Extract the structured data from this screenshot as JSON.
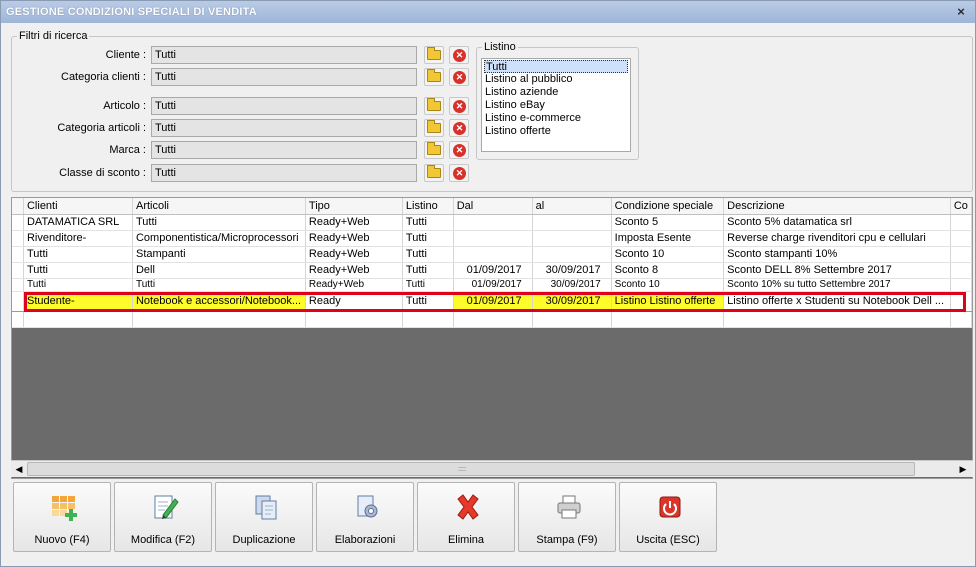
{
  "window": {
    "title": "GESTIONE CONDIZIONI SPECIALI DI VENDITA",
    "close_glyph": "×"
  },
  "filters": {
    "legend": "Filtri di ricerca",
    "rows": [
      {
        "label": "Cliente :",
        "value": "Tutti"
      },
      {
        "label": "Categoria clienti :",
        "value": "Tutti"
      },
      {
        "label": "Articolo :",
        "value": "Tutti"
      },
      {
        "label": "Categoria articoli :",
        "value": "Tutti"
      },
      {
        "label": "Marca :",
        "value": "Tutti"
      },
      {
        "label": "Classe di sconto :",
        "value": "Tutti"
      }
    ]
  },
  "listino": {
    "legend": "Listino",
    "options": [
      "Tutti",
      "Listino al pubblico",
      "Listino aziende",
      "Listino eBay",
      "Listino e-commerce",
      "Listino offerte"
    ],
    "selected": "Tutti"
  },
  "table": {
    "columns": [
      "Clienti",
      "Articoli",
      "Tipo",
      "Listino",
      "Dal",
      "al",
      "Condizione speciale",
      "Descrizione",
      "Co"
    ],
    "rows": [
      [
        "DATAMATICA SRL",
        "Tutti",
        "Ready+Web",
        "Tutti",
        "",
        "",
        "Sconto 5",
        "Sconto 5% datamatica srl"
      ],
      [
        "Rivenditore-",
        "Componentistica/Microprocessori",
        "Ready+Web",
        "Tutti",
        "",
        "",
        "Imposta Esente",
        "Reverse charge rivenditori cpu e cellulari"
      ],
      [
        "Tutti",
        "Stampanti",
        "Ready+Web",
        "Tutti",
        "",
        "",
        "Sconto 10",
        "Sconto stampanti 10%"
      ],
      [
        "Tutti",
        "Dell",
        "Ready+Web",
        "Tutti",
        "01/09/2017",
        "30/09/2017",
        "Sconto 8",
        "Sconto DELL 8% Settembre 2017"
      ],
      [
        "Tutti",
        "Tutti",
        "Ready+Web",
        "Tutti",
        "01/09/2017",
        "30/09/2017",
        "Sconto 10",
        "Sconto 10% su tutto Settembre 2017"
      ],
      [
        "Studente-",
        "Notebook e accessori/Notebook...",
        "Ready",
        "Tutti",
        "01/09/2017",
        "30/09/2017",
        "Listino Listino offerte",
        "Listino offerte x Studenti su Notebook Dell ..."
      ]
    ],
    "highlight_row": 5,
    "highlight_color": "#fdfc2a",
    "outline_color": "#e0001a"
  },
  "buttons": [
    {
      "label": "Nuovo (F4)",
      "icon": "new-grid-icon"
    },
    {
      "label": "Modifica (F2)",
      "icon": "edit-pencil-icon"
    },
    {
      "label": "Duplicazione",
      "icon": "duplicate-icon"
    },
    {
      "label": "Elaborazioni",
      "icon": "process-gear-icon"
    },
    {
      "label": "Elimina",
      "icon": "delete-x-icon"
    },
    {
      "label": "Stampa (F9)",
      "icon": "printer-icon"
    },
    {
      "label": "Uscita (ESC)",
      "icon": "exit-power-icon"
    }
  ]
}
